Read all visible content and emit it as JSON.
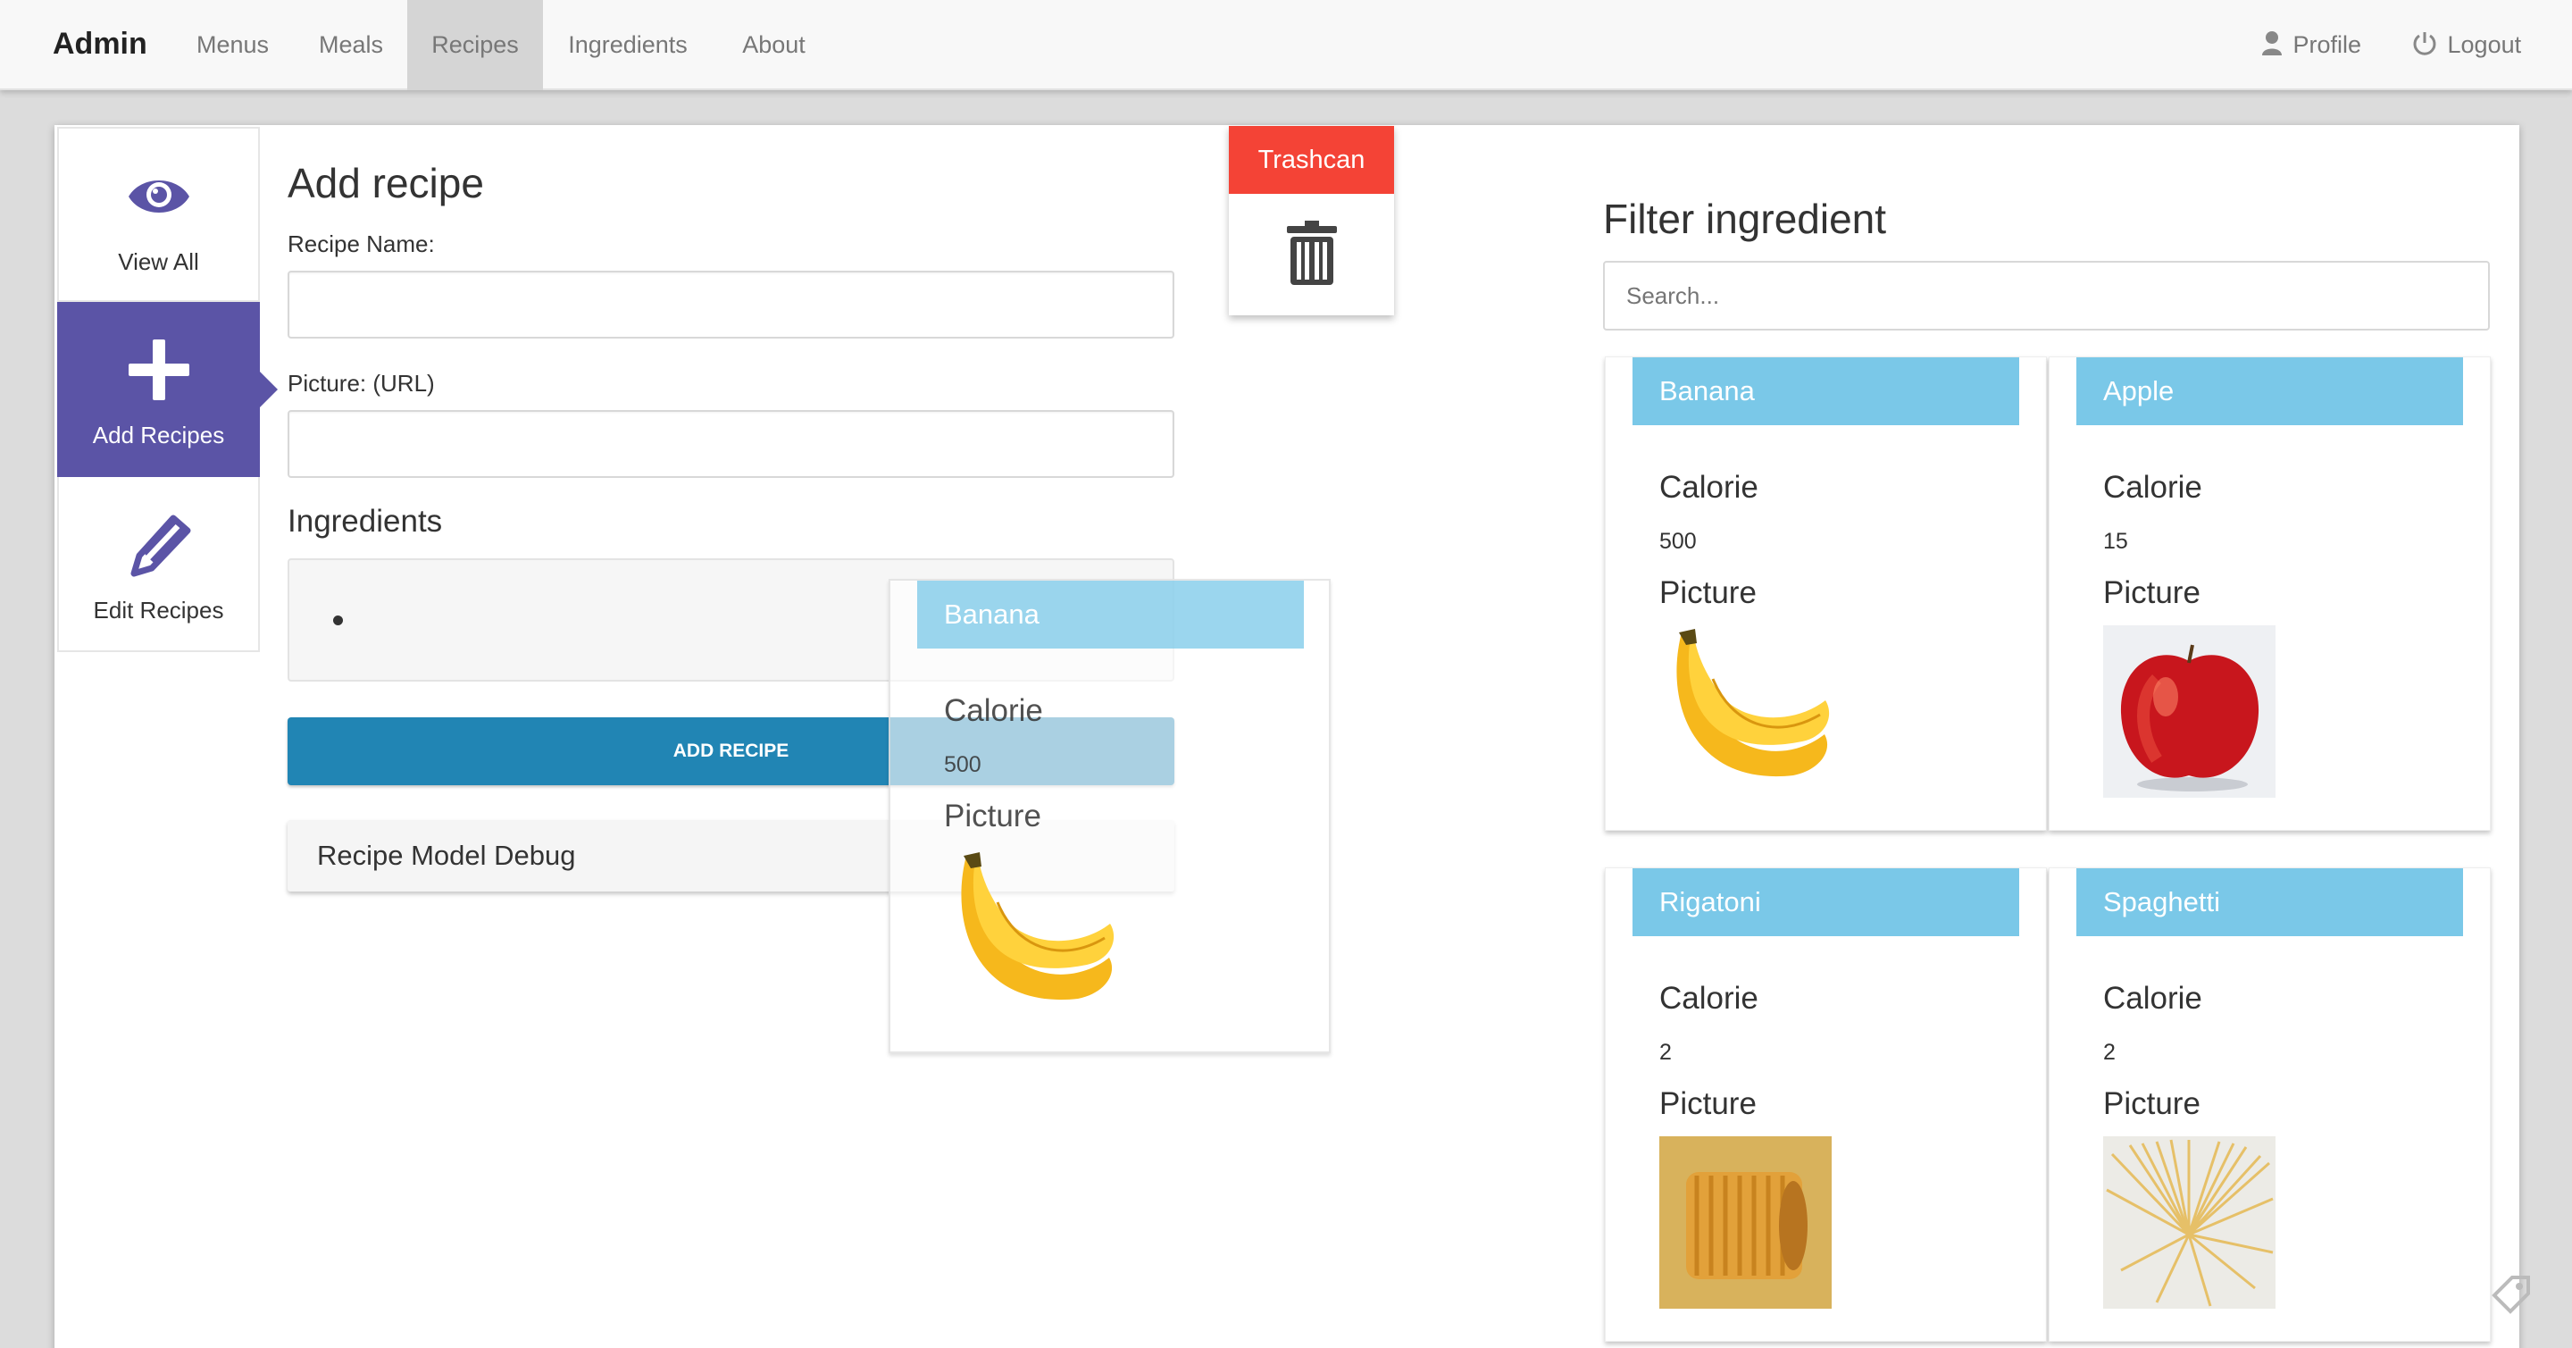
{
  "navbar": {
    "brand": "Admin",
    "items": [
      {
        "label": "Menus"
      },
      {
        "label": "Meals"
      },
      {
        "label": "Recipes",
        "active": true
      },
      {
        "label": "Ingredients"
      },
      {
        "label": "About"
      }
    ],
    "profile": "Profile",
    "logout": "Logout"
  },
  "sidenav": {
    "items": [
      {
        "label": "View All",
        "icon": "eye-icon"
      },
      {
        "label": "Add Recipes",
        "icon": "plus-icon",
        "active": true
      },
      {
        "label": "Edit Recipes",
        "icon": "pencil-icon"
      }
    ]
  },
  "form": {
    "title": "Add recipe",
    "name_label": "Recipe Name:",
    "name_value": "",
    "picture_label": "Picture: (URL)",
    "picture_value": "",
    "ingredients_title": "Ingredients",
    "add_button": "ADD RECIPE",
    "debug_label": "Recipe Model Debug"
  },
  "trashcan": {
    "label": "Trashcan"
  },
  "dragging": {
    "name": "Banana",
    "calorie_label": "Calorie",
    "calorie": "500",
    "picture_label": "Picture",
    "image": "banana"
  },
  "filter": {
    "title": "Filter ingredient",
    "search_placeholder": "Search...",
    "search_value": ""
  },
  "ingredients": [
    {
      "name": "Banana",
      "calorie_label": "Calorie",
      "calorie": "500",
      "picture_label": "Picture",
      "image": "banana"
    },
    {
      "name": "Apple",
      "calorie_label": "Calorie",
      "calorie": "15",
      "picture_label": "Picture",
      "image": "apple"
    },
    {
      "name": "Rigatoni",
      "calorie_label": "Calorie",
      "calorie": "2",
      "picture_label": "Picture",
      "image": "rigatoni"
    },
    {
      "name": "Spaghetti",
      "calorie_label": "Calorie",
      "calorie": "2",
      "picture_label": "Picture",
      "image": "spaghetti"
    }
  ],
  "colors": {
    "accent": "#5b54a6",
    "card_header": "#7ac8e8",
    "primary_button": "#2185b4",
    "trash_header": "#f44336"
  }
}
